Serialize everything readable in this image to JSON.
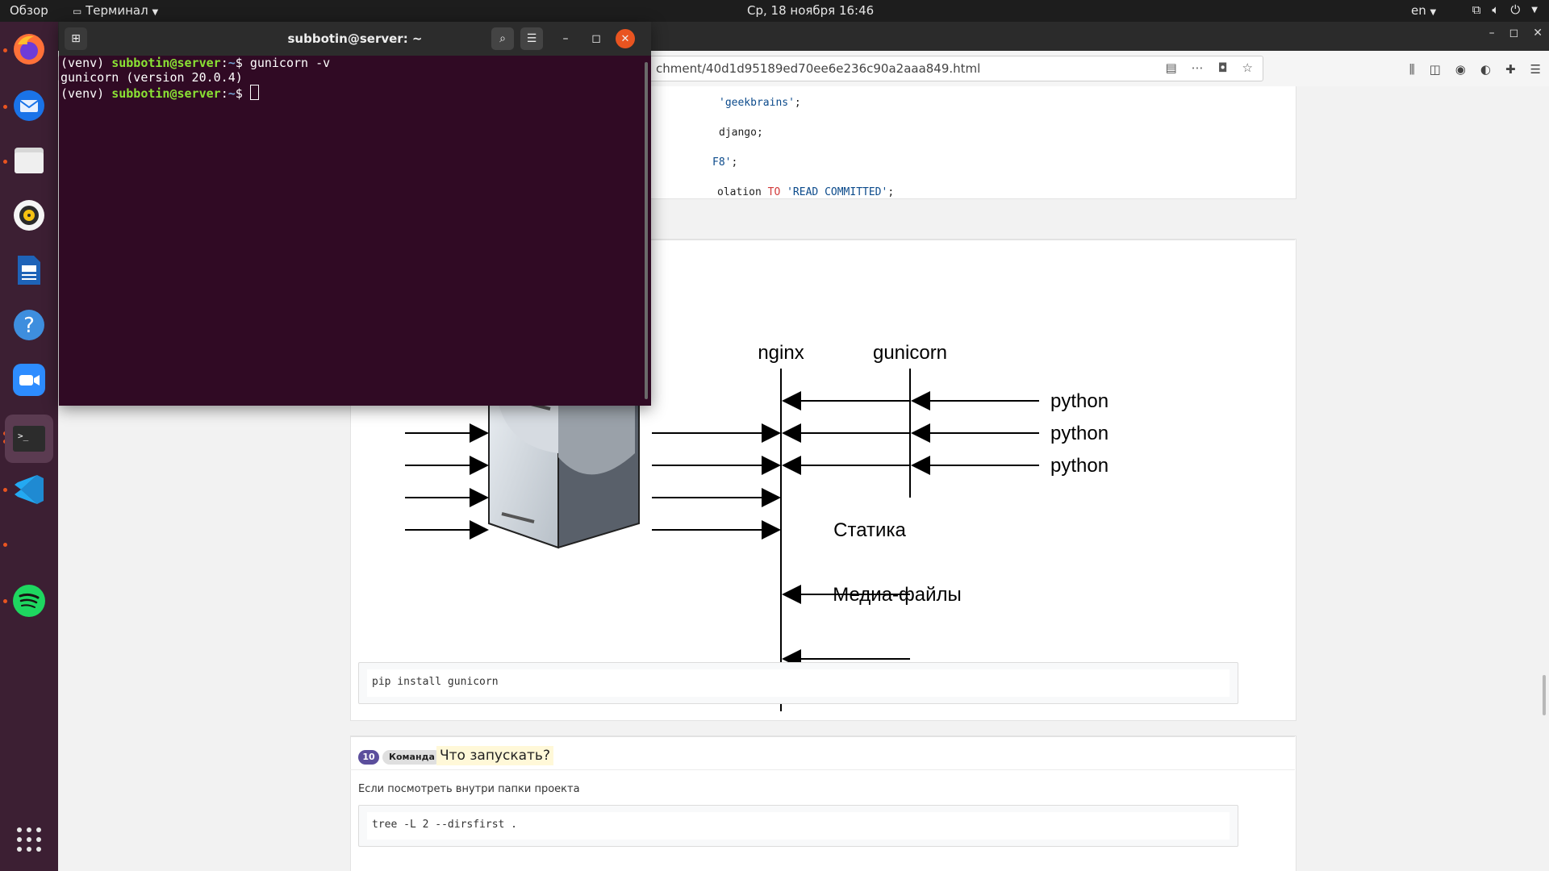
{
  "topbar": {
    "overview": "Обзор",
    "app_menu": "Терминал",
    "clock": "Ср, 18 ноября  16:46",
    "lang": "en"
  },
  "dock": {
    "apps": [
      "firefox-icon",
      "thunderbird-icon",
      "files-icon",
      "rhythmbox-icon",
      "writer-icon",
      "help-icon",
      "zoom-icon",
      "terminal-icon",
      "vscode-icon",
      "spotify-icon"
    ]
  },
  "browser": {
    "url": "chment/40d1d95189ed70ee6e236c90a2aaa849.html"
  },
  "sql_block": {
    "lines": [
      {
        "prefix": "",
        "str": "'geekbrains'",
        "suffix": ";"
      },
      {
        "prefix": "django;",
        "str": "",
        "suffix": ""
      },
      {
        "prefix": "",
        "str": "F8'",
        "suffix": ";"
      },
      {
        "prefix": "olation ",
        "kw": "TO",
        "str": "'READ COMMITTED'",
        "suffix": ";"
      }
    ]
  },
  "diagram": {
    "nginx_label": "nginx",
    "gunicorn_label": "gunicorn",
    "python_labels": [
      "python",
      "python",
      "python"
    ],
    "static_label": "Статика",
    "media_label": "Медиа-файлы"
  },
  "pip_block": {
    "code": "pip install gunicorn"
  },
  "section10": {
    "number": "10",
    "tag": "Команда",
    "title": "Что запускать?",
    "description": "Если посмотреть внутри папки проекта",
    "code": "tree -L 2 --dirsfirst ."
  },
  "terminal": {
    "title": "subbotin@server: ~",
    "lines": [
      {
        "venv": "(venv) ",
        "user": "subbotin@server",
        "sep": ":",
        "path": "~",
        "prompt": "$ ",
        "cmd": "gunicorn -v"
      },
      {
        "output": "gunicorn (version 20.0.4)"
      },
      {
        "venv": "(venv) ",
        "user": "subbotin@server",
        "sep": ":",
        "path": "~",
        "prompt": "$ ",
        "cmd": ""
      }
    ]
  }
}
